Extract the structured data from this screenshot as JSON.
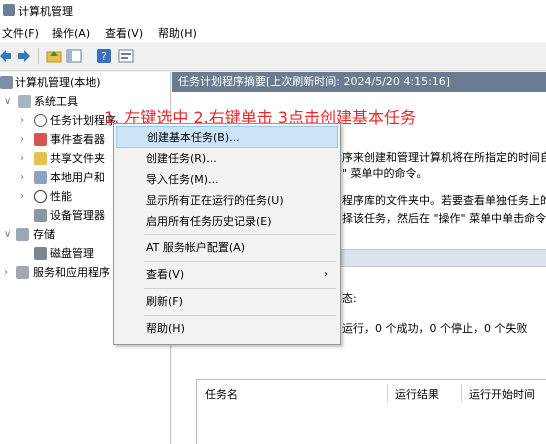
{
  "window": {
    "title": "计算机管理"
  },
  "menubar": {
    "items": [
      "文件(F)",
      "操作(A)",
      "查看(V)",
      "帮助(H)"
    ]
  },
  "toolbar": {
    "icons": [
      "back-arrow-icon",
      "forward-arrow-icon",
      "up-folder-icon",
      "show-hide-tree-icon",
      "help-icon",
      "console-icon"
    ]
  },
  "tree": {
    "root": "计算机管理(本地)",
    "system_tools": "系统工具",
    "task_scheduler": "任务计划程序",
    "event_viewer": "事件查看器",
    "shared_folders": "共享文件夹",
    "local_users": "本地用户和",
    "performance": "性能",
    "device_manager": "设备管理器",
    "storage": "存储",
    "disk_management": "磁盘管理",
    "services_apps": "服务和应用程序"
  },
  "right_pane": {
    "header": "任务计划程序摘要[上次刷新时间: 2024/5/20 4:15:16]",
    "desc_line1": "序来创建和管理计算机将在所指定的时间自",
    "desc_line2": "\" 菜单中的命令。",
    "desc_line3": "程序库的文件夹中。若要查看单独任务上的",
    "desc_line4": "择该任务，然后在 \"操作\" 菜单中单击命令。",
    "status_label": "态:",
    "status_line": "运行，0 个成功，0 个停止，0 个失败",
    "table_headers": [
      "任务名",
      "运行结果",
      "运行开始时间"
    ]
  },
  "instruction": "1. 左键选中 2.右键单击 3点击创建基本任务",
  "context_menu": {
    "items": [
      "创建基本任务(B)...",
      "创建任务(R)...",
      "导入任务(M)...",
      "显示所有正在运行的任务(U)",
      "启用所有任务历史记录(E)",
      "AT 服务帐户配置(A)",
      "查看(V)",
      "刷新(F)",
      "帮助(H)"
    ]
  },
  "colors": {
    "header_bg": "#6a7b92",
    "instruction": "#e8282c",
    "menu_highlight": "#cce4f7"
  }
}
